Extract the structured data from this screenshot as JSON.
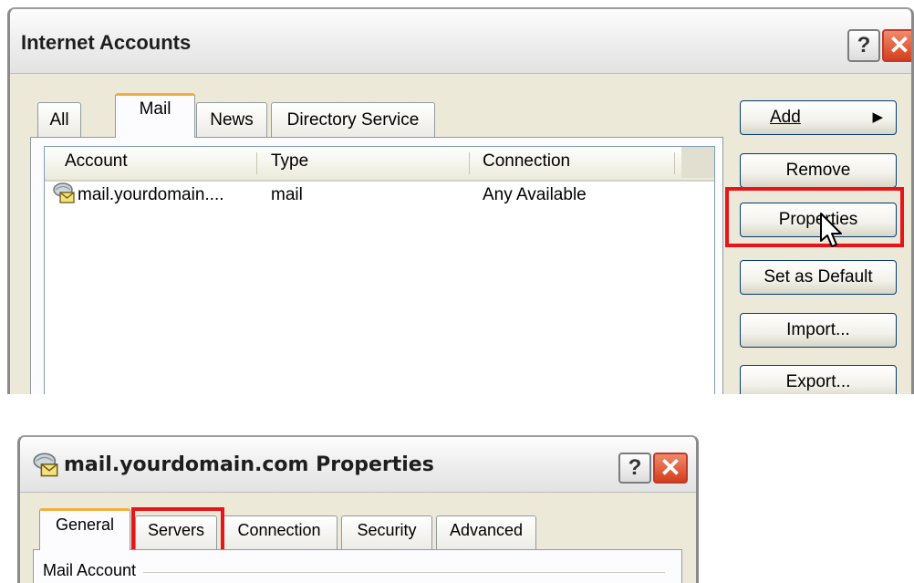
{
  "main_window": {
    "title": "Internet Accounts",
    "help_glyph": "?",
    "close_glyph": "✕",
    "tabs": [
      {
        "label": "All"
      },
      {
        "label": "Mail",
        "selected": true
      },
      {
        "label": "News"
      },
      {
        "label": "Directory Service"
      }
    ],
    "list": {
      "columns": [
        "Account",
        "Type",
        "Connection"
      ],
      "rows": [
        {
          "account": "mail.yourdomain....",
          "type": "mail",
          "connection": "Any Available",
          "icon": "mail-account-icon"
        }
      ]
    },
    "buttons": {
      "add": "Add",
      "add_arrow": "▶",
      "remove": "Remove",
      "properties": "Properties",
      "set_default": "Set as Default",
      "import": "Import...",
      "export": "Export..."
    },
    "highlight_color": "#e8141a"
  },
  "properties_window": {
    "title": "mail.yourdomain.com Properties",
    "help_glyph": "?",
    "close_glyph": "✕",
    "tabs": [
      {
        "label": "General",
        "selected": true
      },
      {
        "label": "Servers"
      },
      {
        "label": "Connection"
      },
      {
        "label": "Security"
      },
      {
        "label": "Advanced"
      }
    ],
    "group_label": "Mail Account"
  }
}
